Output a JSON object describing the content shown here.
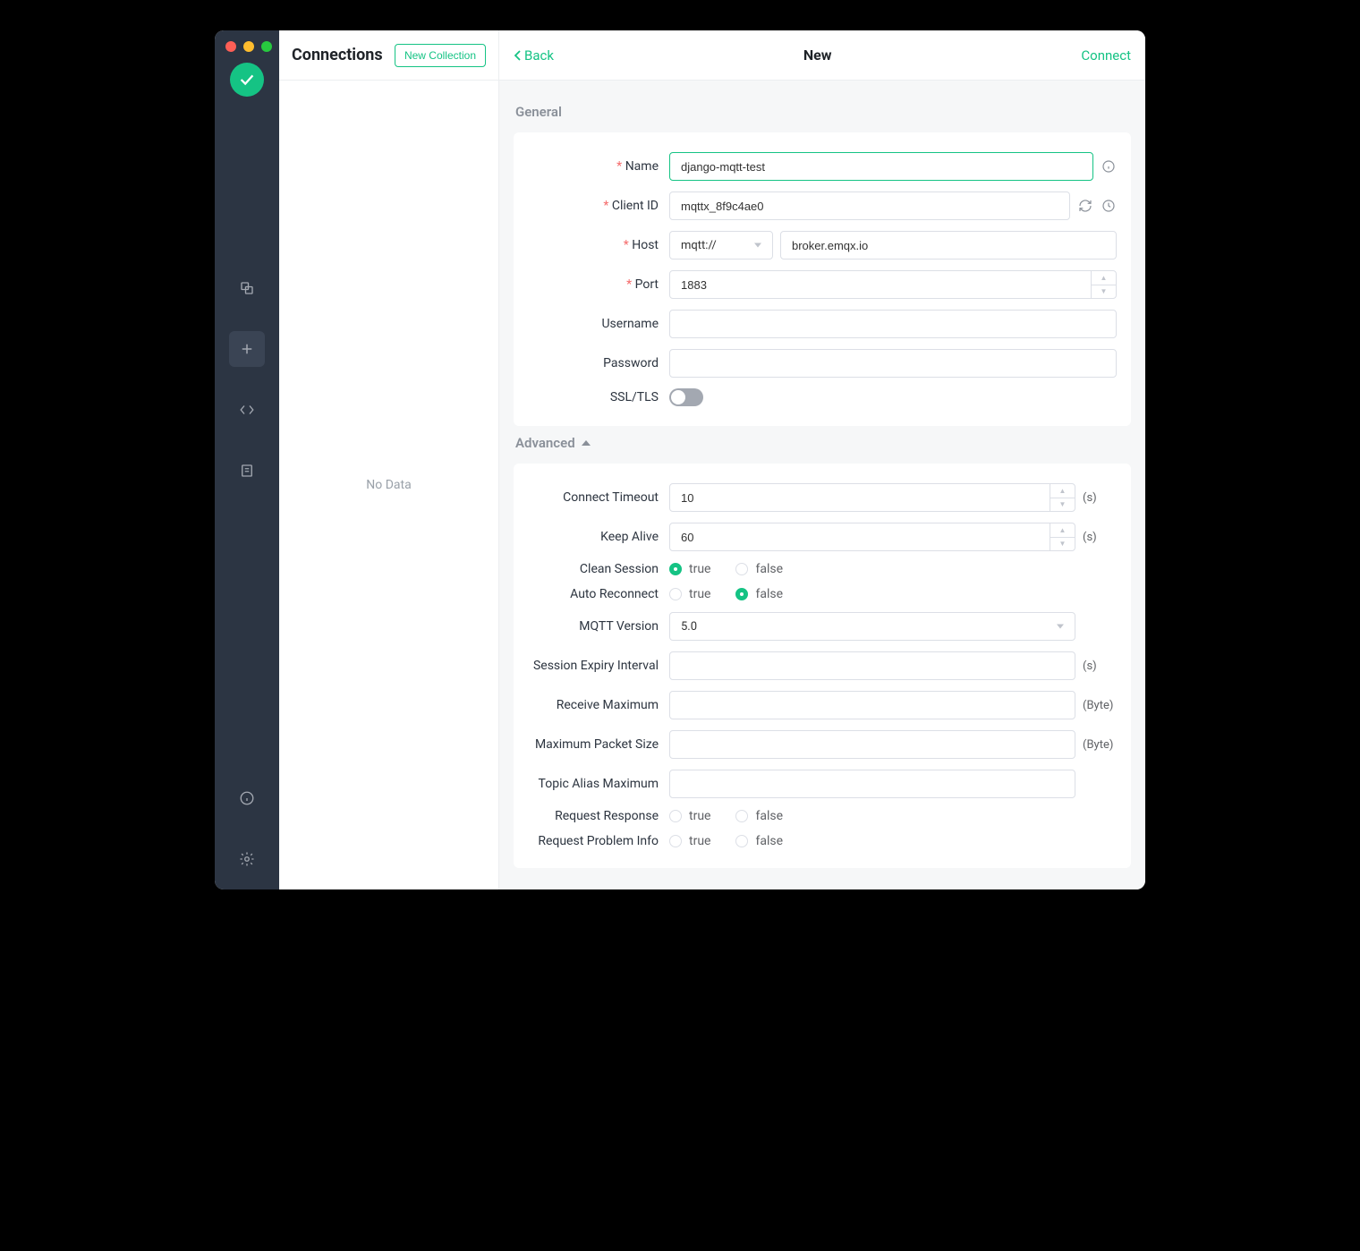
{
  "sidebar": {
    "title": "Connections",
    "new_collection": "New Collection",
    "empty": "No Data"
  },
  "topbar": {
    "back": "Back",
    "title": "New",
    "connect": "Connect"
  },
  "sections": {
    "general": "General",
    "advanced": "Advanced"
  },
  "general": {
    "name_label": "Name",
    "name_value": "django-mqtt-test",
    "client_id_label": "Client ID",
    "client_id_value": "mqttx_8f9c4ae0",
    "host_label": "Host",
    "host_proto": "mqtt://",
    "host_value": "broker.emqx.io",
    "port_label": "Port",
    "port_value": "1883",
    "username_label": "Username",
    "username_value": "",
    "password_label": "Password",
    "password_value": "",
    "ssl_label": "SSL/TLS"
  },
  "advanced": {
    "connect_timeout_label": "Connect Timeout",
    "connect_timeout_value": "10",
    "keep_alive_label": "Keep Alive",
    "keep_alive_value": "60",
    "clean_session_label": "Clean Session",
    "auto_reconnect_label": "Auto Reconnect",
    "mqtt_version_label": "MQTT Version",
    "mqtt_version_value": "5.0",
    "session_expiry_label": "Session Expiry Interval",
    "receive_max_label": "Receive Maximum",
    "max_packet_label": "Maximum Packet Size",
    "topic_alias_label": "Topic Alias Maximum",
    "request_response_label": "Request Response",
    "request_problem_label": "Request Problem Info",
    "true": "true",
    "false": "false",
    "unit_s": "(s)",
    "unit_byte": "(Byte)"
  }
}
